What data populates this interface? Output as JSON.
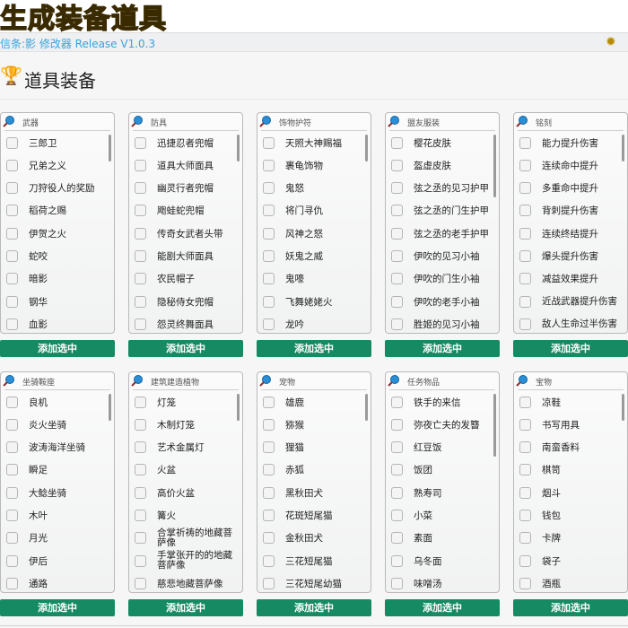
{
  "banner": {
    "title": "生成装备道具"
  },
  "app": {
    "title": "信条:影 修改器 Release V1.0.3",
    "settings_icon": "gear-icon"
  },
  "page": {
    "heading": "道具装备",
    "heading_icon": "trophy-icon"
  },
  "add_label": "添加选中",
  "colors": {
    "button": "#168a63",
    "title_text": "#3aa3db",
    "banner_text": "#f7d54a"
  },
  "panels": [
    {
      "title": "武器",
      "items": [
        "三郎卫",
        "兄弟之义",
        "刀狩役人的奖励",
        "稻荷之赐",
        "伊贺之火",
        "蛇咬",
        "暗影",
        "钢华",
        "血影"
      ]
    },
    {
      "title": "防具",
      "items": [
        "迅捷忍者兜帽",
        "道具大师面具",
        "幽灵行者兜帽",
        "飑蛙蛇兜帽",
        "传奇女武者头带",
        "能剧大师面具",
        "农民帽子",
        "隐秘侍女兜帽",
        "怨灵终舞面具"
      ]
    },
    {
      "title": "饰物护符",
      "items": [
        "天照大神赐福",
        "裹龟饰物",
        "鬼怒",
        "将门寻仇",
        "风神之怒",
        "妖鬼之威",
        "鬼嚎",
        "飞舞姥姥火",
        "龙吟"
      ]
    },
    {
      "title": "盟友服装",
      "items": [
        "樱花皮肤",
        "盔虚皮肤",
        "弦之丞的见习护甲",
        "弦之丞的门生护甲",
        "弦之丞的老手护甲",
        "伊吹的见习小袖",
        "伊吹的门生小袖",
        "伊吹的老手小袖",
        "胜姬的见习小袖"
      ]
    },
    {
      "title": "铭刻",
      "items": [
        "能力提升伤害",
        "连续命中提升",
        "多重命中提升",
        "背刺提升伤害",
        "连续终结提升",
        "爆头提升伤害",
        "减益效果提升",
        "近战武器提升伤害",
        "敌人生命过半伤害"
      ]
    },
    {
      "title": "坐骑鞍座",
      "items": [
        "良机",
        "炎火坐骑",
        "波涛海洋坐骑",
        "瞬足",
        "大鲶坐骑",
        "木叶",
        "月光",
        "伊后",
        "通路"
      ]
    },
    {
      "title": "建筑建造植物",
      "items": [
        "灯笼",
        "木制灯笼",
        "艺术金属灯",
        "火盆",
        "高价火盆",
        "篝火",
        "合掌祈祷的地藏菩萨像",
        "手掌张开的的地藏菩萨像",
        "慈悲地藏菩萨像"
      ]
    },
    {
      "title": "宠物",
      "items": [
        "雄鹿",
        "猕猴",
        "狸猫",
        "赤狐",
        "黑秋田犬",
        "花斑短尾猫",
        "金秋田犬",
        "三花短尾猫",
        "三花短尾幼猫"
      ]
    },
    {
      "title": "任务物品",
      "items": [
        "铁手的来信",
        "弥夜亡夫的发簪",
        "红豆饭",
        "饭团",
        "熟寿司",
        "小菜",
        "素面",
        "乌冬面",
        "味噌汤"
      ]
    },
    {
      "title": "宝物",
      "items": [
        "凉鞋",
        "书写用具",
        "南蛮香料",
        "棋笥",
        "烟斗",
        "钱包",
        "卡牌",
        "袋子",
        "酒瓶"
      ]
    }
  ]
}
